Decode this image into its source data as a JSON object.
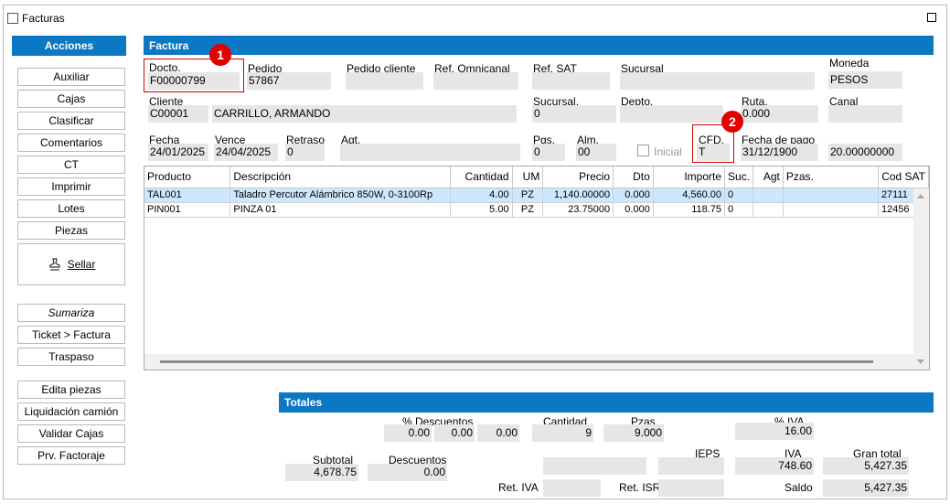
{
  "window": {
    "title": "Facturas"
  },
  "sidebar": {
    "header": "Acciones",
    "buttons": [
      "Auxiliar",
      "Cajas",
      "Clasificar",
      "Comentarios",
      "CT",
      "Imprimir",
      "Lotes",
      "Piezas"
    ],
    "sellar": "Sellar",
    "group2": [
      "Sumariza",
      "Ticket > Factura",
      "Traspaso"
    ],
    "group3": [
      "Edita piezas",
      "Liquidación camión",
      "Validar Cajas",
      "Prv. Factoraje"
    ]
  },
  "factura": {
    "header": "Factura",
    "docto": {
      "label": "Docto.",
      "value": "F00000799"
    },
    "pedido": {
      "label": "Pedido",
      "value": "57867"
    },
    "pedido_cliente": {
      "label": "Pedido cliente",
      "value": ""
    },
    "ref_omnicanal": {
      "label": "Ref. Omnicanal",
      "value": ""
    },
    "ref_sat": {
      "label": "Ref. SAT",
      "value": ""
    },
    "sucursal": {
      "label": "Sucursal",
      "value": ""
    },
    "moneda": {
      "label": "Moneda",
      "value": "PESOS"
    },
    "cliente": {
      "label": "Cliente",
      "code": "C00001",
      "name": "CARRILLO, ARMANDO"
    },
    "sucursal2": {
      "label": "Sucursal.",
      "value": "0"
    },
    "depto": {
      "label": "Depto.",
      "value": ""
    },
    "ruta": {
      "label": "Ruta.",
      "value": "0.000"
    },
    "canal": {
      "label": "Canal",
      "value": ""
    },
    "fecha": {
      "label": "Fecha",
      "value": "24/01/2025"
    },
    "vence": {
      "label": "Vence",
      "value": "24/04/2025"
    },
    "retraso": {
      "label": "Retraso",
      "value": "0"
    },
    "agt": {
      "label": "Agt.",
      "value": ""
    },
    "pgs": {
      "label": "Pgs.",
      "value": "0"
    },
    "alm": {
      "label": "Alm.",
      "value": "00"
    },
    "inicial": {
      "label": "Inicial"
    },
    "cfd": {
      "label": "CFD.",
      "value": "T"
    },
    "fecha_pago": {
      "label": "Fecha de pago",
      "value": "31/12/1900"
    },
    "tipo_cambio": {
      "value": "20.00000000"
    }
  },
  "markers": [
    "1",
    "2"
  ],
  "table": {
    "headers": [
      "Producto",
      "Descripción",
      "Cantidad",
      "UM",
      "Precio",
      "Dto",
      "Importe",
      "Suc.",
      "Agt",
      "Pzas.",
      "Cod SAT"
    ],
    "rows": [
      [
        "TAL001",
        "Taladro Percutor Alámbrico 850W, 0-3100Rp",
        "4.00",
        "PZ",
        "1,140.00000",
        "0.000",
        "4,560.00",
        "0",
        "",
        "",
        "27111"
      ],
      [
        "PIN001",
        "PINZA 01",
        "5.00",
        "PZ",
        "23.75000",
        "0.000",
        "118.75",
        "0",
        "",
        "",
        "12456"
      ]
    ]
  },
  "totales": {
    "header": "Totales",
    "descuentos_pct": {
      "label": "% Descuentos",
      "values": [
        "0.00",
        "0.00",
        "0.00"
      ]
    },
    "cantidad": {
      "label": "Cantidad",
      "value": "9"
    },
    "pzas": {
      "label": "Pzas.",
      "value": "9.000"
    },
    "iva_pct": {
      "label": "% IVA",
      "value": "16.00"
    },
    "subtotal": {
      "label": "Subtotal",
      "value": "4,678.75"
    },
    "descuentos": {
      "label": "Descuentos",
      "value": "0.00"
    },
    "ieps": {
      "label": "IEPS",
      "value": ""
    },
    "iva": {
      "label": "IVA",
      "value": "748.60"
    },
    "gran_total": {
      "label": "Gran total",
      "value": "5,427.35"
    },
    "ret_iva": {
      "label": "Ret. IVA",
      "value": ""
    },
    "ret_isr": {
      "label": "Ret. ISR",
      "value": ""
    },
    "saldo": {
      "label": "Saldo",
      "value": "5,427.35"
    }
  }
}
